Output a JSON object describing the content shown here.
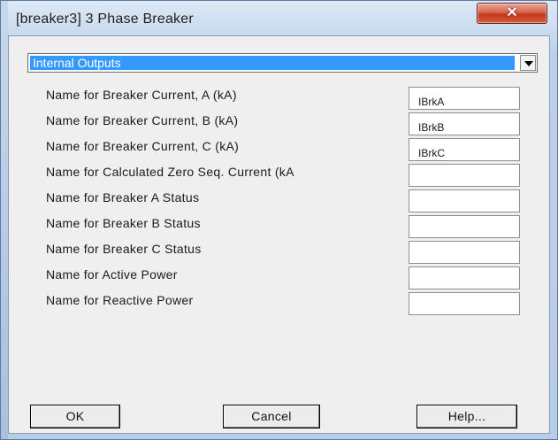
{
  "window": {
    "title": "[breaker3] 3 Phase Breaker",
    "close_icon": "close-icon",
    "close_glyph": "✕"
  },
  "category": {
    "selected": "Internal Outputs",
    "arrow_icon": "chevron-down-icon"
  },
  "fields": [
    {
      "label": "Name for Breaker Current, A (kA)",
      "value": "IBrkA"
    },
    {
      "label": "Name for Breaker Current, B (kA)",
      "value": "IBrkB"
    },
    {
      "label": "Name for Breaker Current, C (kA)",
      "value": "IBrkC"
    },
    {
      "label": "Name for Calculated Zero Seq. Current (kA",
      "value": ""
    },
    {
      "label": "Name for Breaker A Status",
      "value": ""
    },
    {
      "label": "Name for Breaker B Status",
      "value": ""
    },
    {
      "label": "Name for Breaker C Status",
      "value": ""
    },
    {
      "label": "Name for Active Power",
      "value": ""
    },
    {
      "label": "Name for Reactive Power",
      "value": ""
    }
  ],
  "buttons": {
    "ok": "OK",
    "cancel": "Cancel",
    "help": "Help..."
  }
}
